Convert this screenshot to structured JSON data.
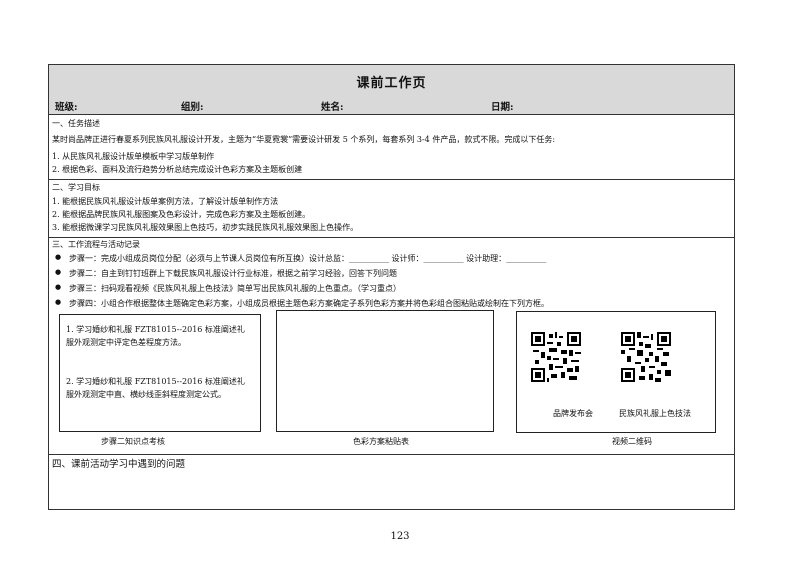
{
  "title": "课前工作页",
  "info": {
    "class_label": "班级:",
    "group_label": "组别:",
    "name_label": "姓名:",
    "date_label": "日期:"
  },
  "section1": {
    "heading": "一、任务描述",
    "body": "某时尚品牌正进行春夏系列民族风礼服设计开发，主题为“华夏霓裳”需要设计研发 5 个系列，每套系列 3-4 件产品，款式不限。完成以下任务:",
    "items": [
      "1. 从民族风礼服设计版单模板中学习版单制作",
      "2. 根据色彩、面料及流行趋势分析总结完成设计色彩方案及主题板创建"
    ]
  },
  "section2": {
    "heading": "二、学习目标",
    "items": [
      "1.    能根据民族风礼服设计版单案例方法，了解设计版单制作方法",
      "2.    能根据品牌民族风礼服图案及色彩设计，完成色彩方案及主题板创建。",
      "3.    能根据微课学习民族风礼服效果图上色技巧，初步实践民族风礼服效果图上色操作。"
    ]
  },
  "section3": {
    "heading": "三、工作流程与活动记录",
    "steps": [
      "步骤一：完成小组成员岗位分配（必须与上节课人员岗位有所互换）设计总监：__________   设计师：__________   设计助理：__________",
      "步骤二：自主到钉钉班群上下载民族风礼服设计行业标准，根据之前学习经验，回答下列问题",
      "步骤三：扫码观看视频《民族风礼服上色技法》简单写出民族风礼服的上色重点。（学习重点）",
      "步骤四：小组合作根据整体主题确定色彩方案，小组成员根据主题色彩方案确定子系列色彩方案并将色彩组合图粘贴或绘制在下列方框。"
    ],
    "box1": {
      "q1": "1.  学习婚纱和礼服 FZT81015--2016 标准阐述礼服外观测定中评定色差程度方法。",
      "q2": "2.  学习婚纱和礼服 FZT81015--2016 标准阐述礼服外观测定中直、横纱线歪斜程度测定公式。",
      "caption": "步骤二知识点考核"
    },
    "box2": {
      "caption": "色彩方案粘贴表"
    },
    "box3": {
      "qr1_label": "品牌发布会",
      "qr2_label": "民族风礼服上色技法",
      "caption": "视频二维码"
    }
  },
  "section4": {
    "heading": "四、课前活动学习中遇到的问题"
  },
  "page_number": "123"
}
